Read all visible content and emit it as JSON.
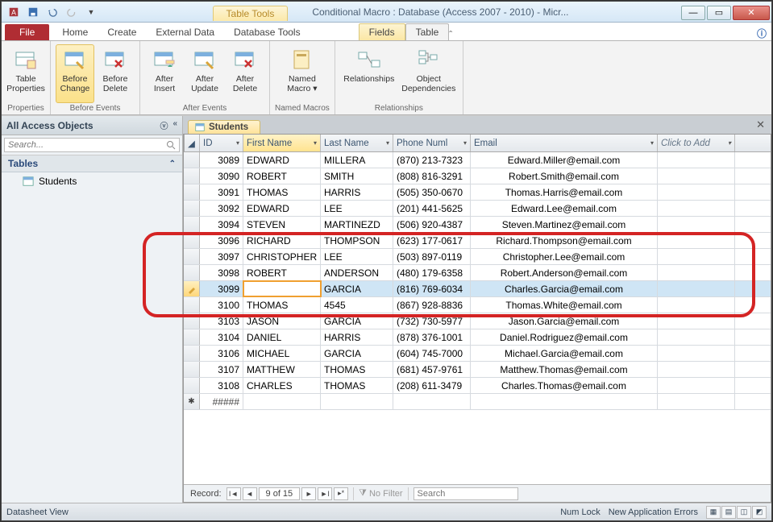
{
  "titlebar": {
    "table_tools": "Table Tools",
    "title": "Conditional Macro : Database (Access 2007 - 2010) -  Micr..."
  },
  "menu": {
    "file": "File",
    "home": "Home",
    "create": "Create",
    "external": "External Data",
    "dbtools": "Database Tools",
    "fields": "Fields",
    "table": "Table"
  },
  "ribbon": {
    "properties": {
      "table_properties": "Table\nProperties",
      "group": "Properties"
    },
    "before": {
      "change": "Before\nChange",
      "delete": "Before\nDelete",
      "group": "Before Events"
    },
    "after": {
      "insert": "After\nInsert",
      "update": "After\nUpdate",
      "delete": "After\nDelete",
      "group": "After Events"
    },
    "named": {
      "macro": "Named\nMacro ▾",
      "group": "Named Macros"
    },
    "rel": {
      "relationships": "Relationships",
      "deps": "Object\nDependencies",
      "group": "Relationships"
    }
  },
  "nav": {
    "title": "All Access Objects",
    "search_ph": "Search...",
    "group": "Tables",
    "item1": "Students"
  },
  "doc": {
    "tab": "Students"
  },
  "grid": {
    "headers": {
      "id": "ID",
      "fn": "First Name",
      "ln": "Last Name",
      "ph": "Phone Numl",
      "em": "Email",
      "add": "Click to Add"
    },
    "rows": [
      {
        "id": "3089",
        "fn": "EDWARD",
        "ln": "MILLERA",
        "ph": "(870) 213-7323",
        "em": "Edward.Miller@email.com"
      },
      {
        "id": "3090",
        "fn": "ROBERT",
        "ln": "SMITH",
        "ph": "(808) 816-3291",
        "em": "Robert.Smith@email.com"
      },
      {
        "id": "3091",
        "fn": "THOMAS",
        "ln": "HARRIS",
        "ph": "(505) 350-0670",
        "em": "Thomas.Harris@email.com"
      },
      {
        "id": "3092",
        "fn": "EDWARD",
        "ln": "LEE",
        "ph": "(201) 441-5625",
        "em": "Edward.Lee@email.com"
      },
      {
        "id": "3094",
        "fn": "STEVEN",
        "ln": "MARTINEZD",
        "ph": "(506) 920-4387",
        "em": "Steven.Martinez@email.com"
      },
      {
        "id": "3096",
        "fn": "RICHARD",
        "ln": "THOMPSON",
        "ph": "(623) 177-0617",
        "em": "Richard.Thompson@email.com"
      },
      {
        "id": "3097",
        "fn": "CHRISTOPHER",
        "ln": "LEE",
        "ph": "(503) 897-0119",
        "em": "Christopher.Lee@email.com"
      },
      {
        "id": "3098",
        "fn": "ROBERT",
        "ln": "ANDERSON",
        "ph": "(480) 179-6358",
        "em": "Robert.Anderson@email.com"
      },
      {
        "id": "3099",
        "fn": "",
        "ln": "GARCIA",
        "ph": "(816) 769-6034",
        "em": "Charles.Garcia@email.com",
        "selected": true,
        "editing": true
      },
      {
        "id": "3100",
        "fn": "THOMAS",
        "ln": "4545",
        "ph": "(867) 928-8836",
        "em": "Thomas.White@email.com"
      },
      {
        "id": "3103",
        "fn": "JASON",
        "ln": "GARCIA",
        "ph": "(732) 730-5977",
        "em": "Jason.Garcia@email.com"
      },
      {
        "id": "3104",
        "fn": "DANIEL",
        "ln": "HARRIS",
        "ph": "(878) 376-1001",
        "em": "Daniel.Rodriguez@email.com"
      },
      {
        "id": "3106",
        "fn": "MICHAEL",
        "ln": "GARCIA",
        "ph": "(604) 745-7000",
        "em": "Michael.Garcia@email.com"
      },
      {
        "id": "3107",
        "fn": "MATTHEW",
        "ln": "THOMAS",
        "ph": "(681) 457-9761",
        "em": "Matthew.Thomas@email.com"
      },
      {
        "id": "3108",
        "fn": "CHARLES",
        "ln": "THOMAS",
        "ph": "(208) 611-3479",
        "em": "Charles.Thomas@email.com"
      }
    ],
    "newrow_hash": "#####"
  },
  "recnav": {
    "label": "Record:",
    "pos": "9 of 15",
    "nofilter": "No Filter",
    "search_ph": "Search"
  },
  "status": {
    "view": "Datasheet View",
    "numlock": "Num Lock",
    "errors": "New Application Errors"
  }
}
